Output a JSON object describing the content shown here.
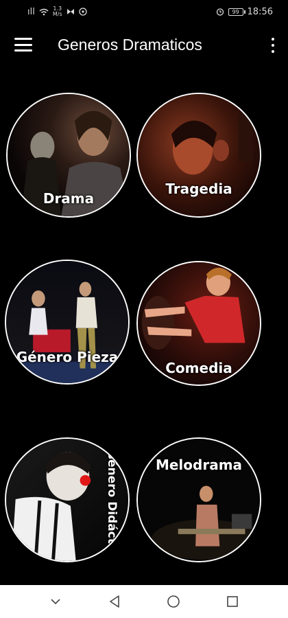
{
  "status_bar": {
    "signal_text": "ıll",
    "net_speed_top": "1.3",
    "net_speed_bottom": "M/s",
    "battery_text": "99",
    "time": "18:56"
  },
  "app_bar": {
    "title": "Generos Dramaticos",
    "menu_icon": "hamburger-icon",
    "overflow_icon": "more-vert-icon"
  },
  "genres": [
    {
      "label": "Drama",
      "accent": "#6b2a1c"
    },
    {
      "label": "Tragedia",
      "accent": "#7a1e10"
    },
    {
      "label": "Género Pieza",
      "accent": "#b01825"
    },
    {
      "label": "Comedia",
      "accent": "#d43a1e"
    },
    {
      "label": "Género Didáctico",
      "accent": "#c41a1a"
    },
    {
      "label": "Melodrama",
      "accent": "#8a6a50"
    }
  ],
  "nav_bar": {
    "back_icon": "back-triangle-icon",
    "home_icon": "home-circle-icon",
    "recents_icon": "recents-square-icon",
    "collapse_icon": "chevron-down-icon"
  }
}
